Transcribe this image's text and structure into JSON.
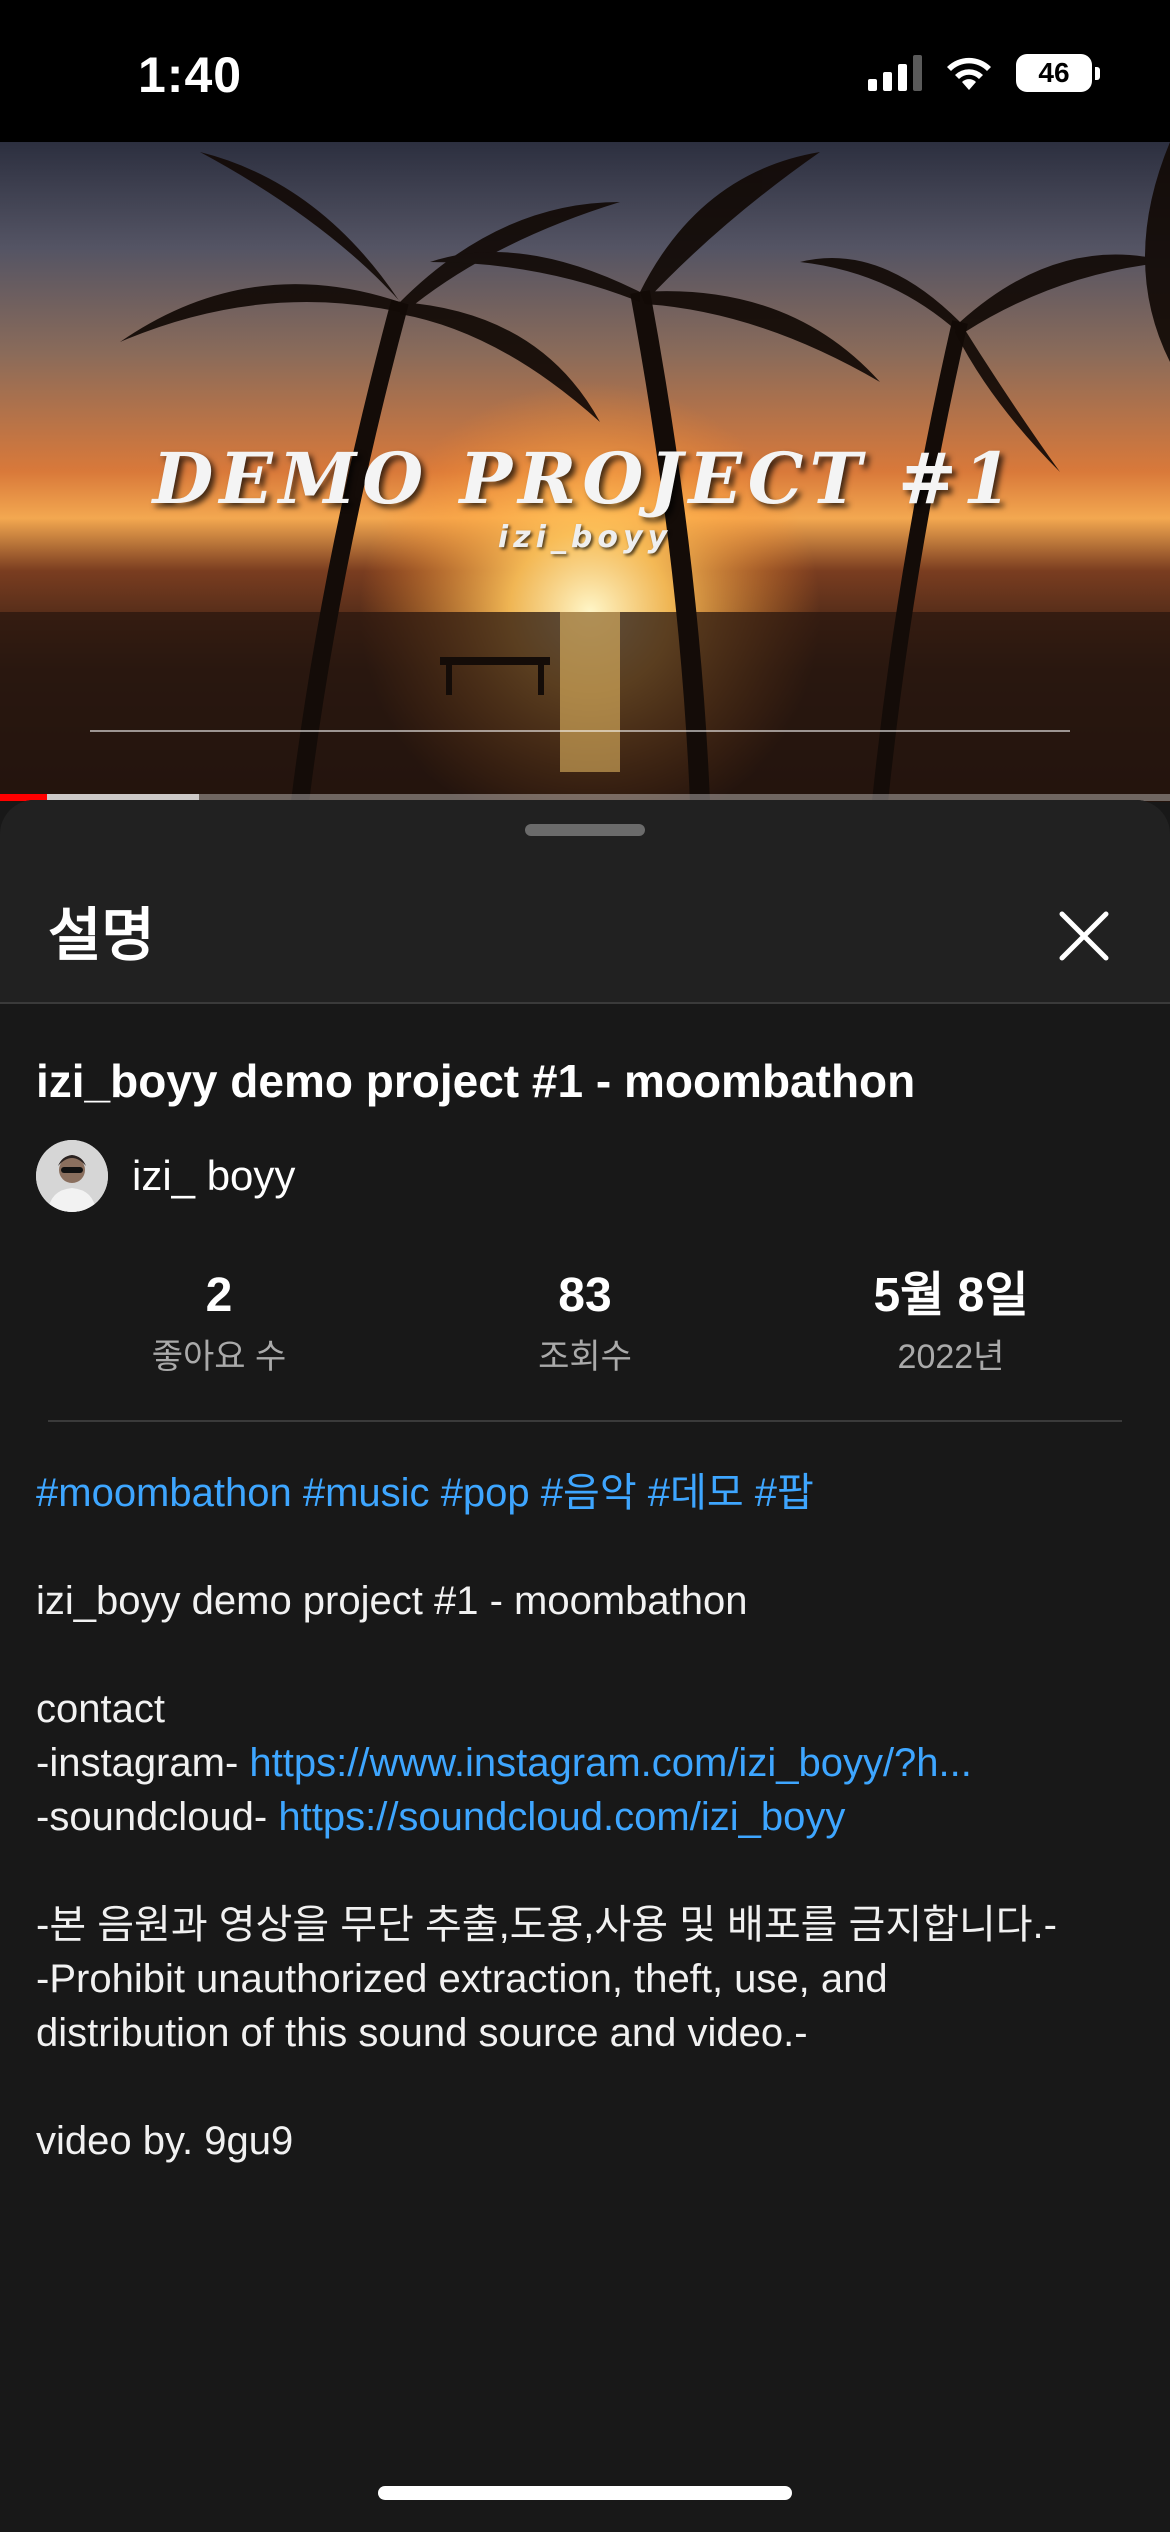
{
  "status_bar": {
    "time": "1:40",
    "battery": "46",
    "icons": [
      "cellular-signal-icon",
      "wifi-icon",
      "battery-icon"
    ]
  },
  "video": {
    "title_art": "DEMO PROJECT #1",
    "subtitle_art": "izi_boyy",
    "progress": 0.04,
    "buffered": 0.17,
    "progress_color": "#ff0000"
  },
  "sheet": {
    "title": "설명",
    "close_icon": "close-icon"
  },
  "details": {
    "video_title": "izi_boyy demo project #1 - moombathon",
    "channel_name": "izi_ boyy",
    "stats": [
      {
        "value": "2",
        "label": "좋아요 수"
      },
      {
        "value": "83",
        "label": "조회수"
      },
      {
        "value": "5월 8일",
        "label": "2022년"
      }
    ]
  },
  "description": {
    "hashtags": [
      "#moombathon",
      "#music",
      "#pop",
      "#음악",
      "#데모",
      "#팝"
    ],
    "line1": "izi_boyy demo project #1 - moombathon",
    "contact": "contact",
    "instagram_label": "-instagram- ",
    "instagram_link": "https://www.instagram.com/izi_boyy/?h...",
    "soundcloud_label": "-soundcloud- ",
    "soundcloud_link": "https://soundcloud.com/izi_boyy",
    "notice_ko": "-본 음원과 영상을 무단 추출,도용,사용 및 배포를 금지합니다.-",
    "notice_en_1": "-Prohibit unauthorized extraction, theft, use, and",
    "notice_en_2": "distribution of this sound source and video.-",
    "credit": "video by. 9gu9"
  },
  "colors": {
    "accent_link": "#3ea6ff",
    "background": "#181818",
    "header": "#212121"
  }
}
